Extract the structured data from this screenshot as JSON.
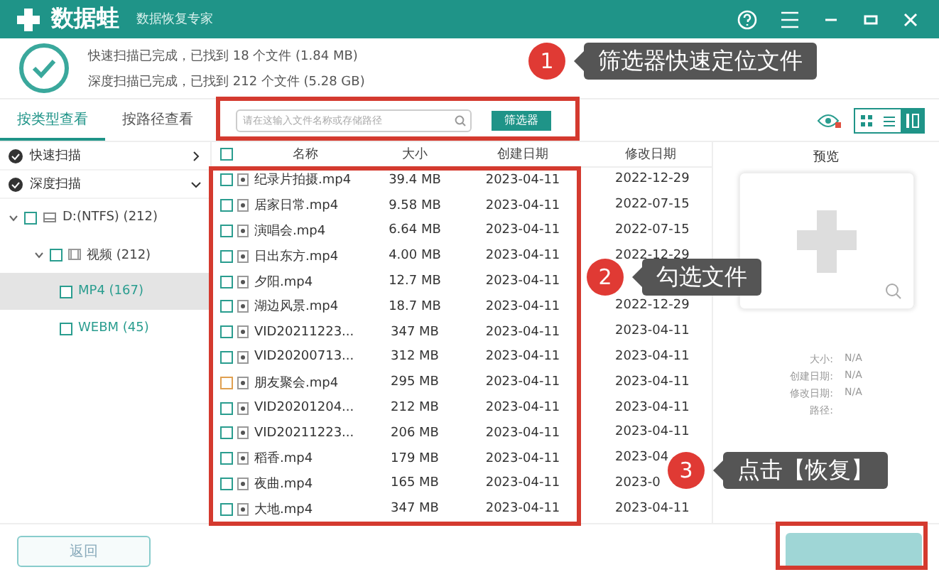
{
  "app": {
    "name": "数据蛙",
    "subtitle": "数据恢复专家"
  },
  "scan_status": [
    "快速扫描已完成，已找到 18 个文件 (1.84 MB)",
    "深度扫描已完成，已找到 212 个文件 (5.28 GB)"
  ],
  "tabs": [
    {
      "label": "按类型查看",
      "selected": true
    },
    {
      "label": "按路径查看",
      "selected": false
    }
  ],
  "search": {
    "placeholder": "请在这输入文件名称或存储路径"
  },
  "filter_button": "筛选器",
  "view_modes": [
    {
      "kind": "grid",
      "selected": false
    },
    {
      "kind": "list",
      "selected": false
    },
    {
      "kind": "detail",
      "selected": true
    }
  ],
  "sidebar": {
    "scans": [
      {
        "label": "快速扫描",
        "expanded": false
      },
      {
        "label": "深度扫描",
        "expanded": true
      }
    ],
    "tree": [
      {
        "label": "D:(NTFS) (212)",
        "kind": "drive",
        "checked": false,
        "expanded": true,
        "children": [
          {
            "label": "视频 (212)",
            "kind": "folder",
            "checked": false,
            "expanded": true,
            "children": [
              {
                "label": "MP4 (167)",
                "kind": "type",
                "checked": false,
                "selected": true
              },
              {
                "label": "WEBM (45)",
                "kind": "type",
                "checked": false,
                "selected": false
              }
            ]
          }
        ]
      }
    ]
  },
  "table": {
    "select_all": false,
    "columns": [
      "名称",
      "大小",
      "创建日期",
      "修改日期"
    ],
    "rows": [
      {
        "checked": false,
        "name": "纪录片拍摄.mp4",
        "size": "39.4 MB",
        "created": "2023-04-11",
        "modified": "2022-12-29"
      },
      {
        "checked": false,
        "name": "居家日常.mp4",
        "size": "9.58 MB",
        "created": "2023-04-11",
        "modified": "2022-07-15"
      },
      {
        "checked": false,
        "name": "演唱会.mp4",
        "size": "6.64 MB",
        "created": "2023-04-11",
        "modified": "2022-07-15"
      },
      {
        "checked": false,
        "name": "日出东方.mp4",
        "size": "4.00 MB",
        "created": "2023-04-11",
        "modified": "2022-12-29"
      },
      {
        "checked": false,
        "name": "夕阳.mp4",
        "size": "12.7 MB",
        "created": "2023-04-11"
      },
      {
        "checked": false,
        "name": "湖边风景.mp4",
        "size": "18.7 MB",
        "created": "2023-04-11",
        "modified": "2022-12-29"
      },
      {
        "checked": false,
        "name": "VID20211223...",
        "size": "347 MB",
        "created": "2023-04-11",
        "modified": "2023-04-11"
      },
      {
        "checked": false,
        "name": "VID20200713...",
        "size": "312 MB",
        "created": "2023-04-11",
        "modified": "2023-04-11"
      },
      {
        "checked": false,
        "name": "朋友聚会.mp4",
        "size": "295 MB",
        "created": "2023-04-11",
        "modified": "2023-04-11"
      },
      {
        "checked": false,
        "name": "VID20201204...",
        "size": "212 MB",
        "created": "2023-04-11",
        "modified": "2023-04-11"
      },
      {
        "checked": false,
        "name": "VID20211223...",
        "size": "206 MB",
        "created": "2023-04-11",
        "modified": "2023-04-11"
      },
      {
        "checked": false,
        "name": "稻香.mp4",
        "size": "179 MB",
        "created": "2023-04-11",
        "modified": "2023-04"
      },
      {
        "checked": false,
        "name": "夜曲.mp4",
        "size": "165 MB",
        "created": "2023-04-11",
        "modified": "2023-0"
      },
      {
        "checked": false,
        "name": "大地.mp4",
        "size": "347 MB",
        "created": "2023-04-11",
        "modified": "2023-04-11"
      }
    ]
  },
  "preview": {
    "title": "预览",
    "fields": [
      {
        "label": "大小:",
        "value": "N/A"
      },
      {
        "label": "创建日期:",
        "value": "N/A"
      },
      {
        "label": "修改日期:",
        "value": "N/A"
      },
      {
        "label": "路径:"
      }
    ]
  },
  "back_button": "返回",
  "annotations": [
    {
      "number": "1",
      "text": "筛选器快速定位文件"
    },
    {
      "number": "2",
      "text": "勾选文件"
    },
    {
      "number": "3",
      "text": "点击【恢复】"
    }
  ]
}
